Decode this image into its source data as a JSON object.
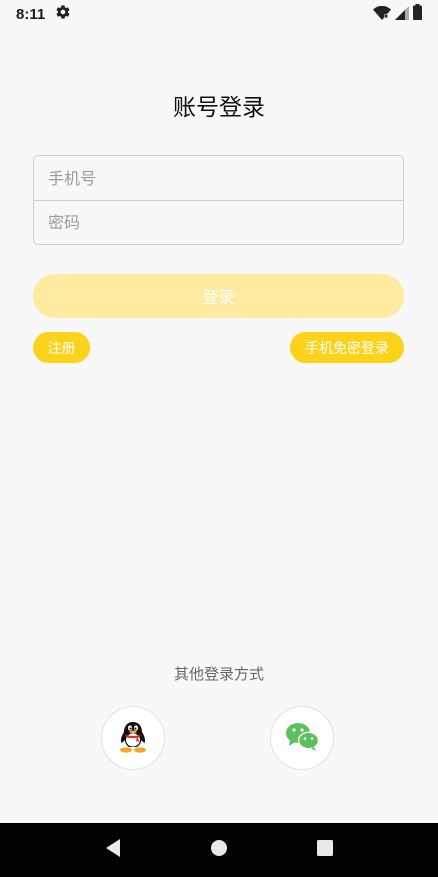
{
  "status_bar": {
    "time": "8:11",
    "icons": [
      "settings-gear",
      "wifi",
      "cellular-signal",
      "battery"
    ]
  },
  "page": {
    "title": "账号登录"
  },
  "form": {
    "phone_placeholder": "手机号",
    "password_placeholder": "密码"
  },
  "buttons": {
    "login_label": "登录",
    "register_label": "注册",
    "sms_login_label": "手机免密登录"
  },
  "other_login": {
    "label": "其他登录方式",
    "methods": [
      "qq-icon",
      "wechat-icon"
    ]
  },
  "nav_bar": {
    "icons": [
      "back-triangle",
      "home-circle",
      "recents-square"
    ]
  },
  "colors": {
    "background": "#f8f8f8",
    "accent": "#fcd21b",
    "login_button_disabled": "#feeba1",
    "wechat": "#5bc15b"
  }
}
